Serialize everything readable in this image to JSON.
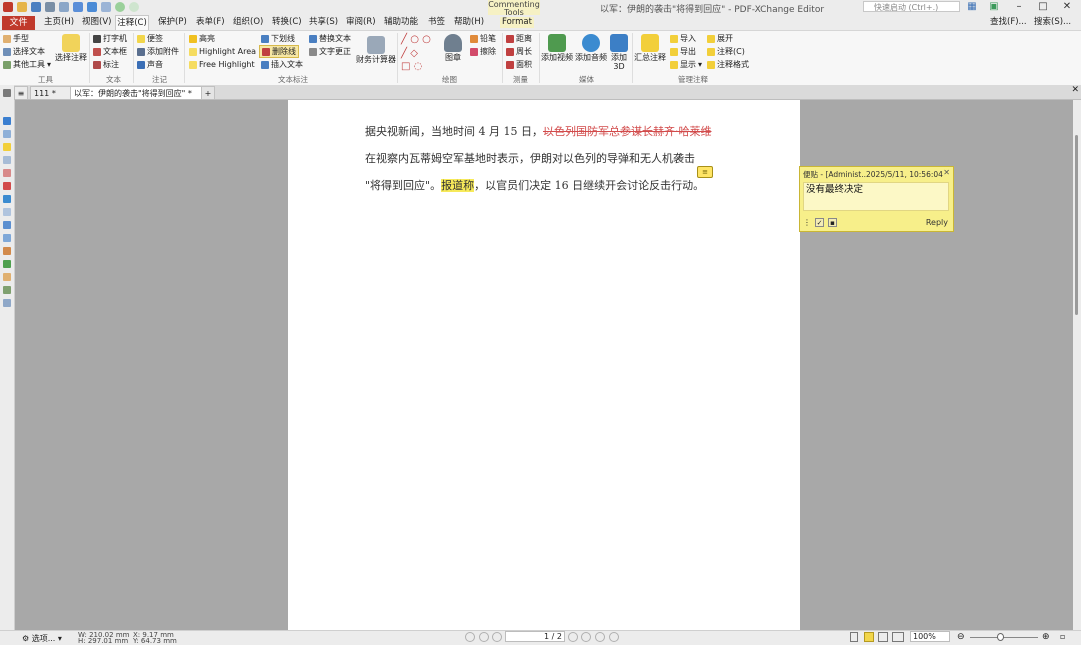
{
  "window": {
    "title": "以军：伊朗的袭击\"将得到回应\" - PDF-XChange Editor",
    "quick_launch_placeholder": "快速启动 (Ctrl+.)",
    "context_group_label": "Commenting Tools"
  },
  "menu": {
    "file": "文件",
    "tabs": [
      "主页(H)",
      "视图(V)",
      "注释(C)",
      "保护(P)",
      "表单(F)",
      "组织(O)",
      "转换(C)",
      "共享(S)",
      "审阅(R)",
      "辅助功能",
      "书签",
      "帮助(H)"
    ],
    "context_tab": "Format",
    "find": "查找(F)...",
    "search": "搜索(S)..."
  },
  "ribbon": {
    "tools": {
      "hand": "手型",
      "select_text": "选择文本",
      "other_tools": "其他工具",
      "group": "工具"
    },
    "select_comment": "选择注释",
    "text": {
      "typewriter": "打字机",
      "textbox": "文本框",
      "callout": "标注",
      "group": "文本"
    },
    "notes": {
      "sticky": "便签",
      "attach_file": "添加附件",
      "sound": "声音",
      "group": "注记"
    },
    "markup": {
      "highlight": "高亮",
      "highlight_area": "Highlight Area",
      "free_highlight": "Free Highlight",
      "underline": "下划线",
      "strikeout": "删除线",
      "insert_text": "插入文本",
      "replace_text": "替换文本",
      "text_correct": "文字更正",
      "group": "文本标注"
    },
    "calculator": "财务计算器",
    "drawing": {
      "stamp": "图章",
      "pencil": "铅笔",
      "eraser": "擦除",
      "group": "绘图"
    },
    "measure": {
      "distance": "距离",
      "perimeter": "周长",
      "area": "面积",
      "group": "测量"
    },
    "media": {
      "add_video": "添加视频",
      "add_audio": "添加音频",
      "add_3d": "添加3D",
      "group": "媒体"
    },
    "manage": {
      "summarize": "汇总注释",
      "import": "导入",
      "export": "导出",
      "show": "显示",
      "expand": "展开",
      "comments": "注释(C)",
      "comment_format": "注释格式",
      "group": "管理注释"
    }
  },
  "doc_tabs": [
    "111 *",
    "以军：伊朗的袭击\"将得到回应\" *"
  ],
  "document": {
    "line1_pre": "据央视新闻，当地时间 4 月 15 日，",
    "line1_strike": "以色列国防军总参谋长赫齐·哈莱维",
    "line2": "在视察内瓦蒂姆空军基地时表示，伊朗对以色列的导弹和无人机袭击",
    "line3_pre": "\"将得到回应\"。",
    "line3_highlight": "报道称",
    "line3_post": "，以官员们决定 16 日继续开会讨论反击行动。"
  },
  "note_popup": {
    "header": "便贴 - [Administ..2025/5/11, 10:56:04",
    "body": "没有最终决定",
    "reply": "Reply"
  },
  "status": {
    "options": "选项...",
    "width": "W: 210.02 mm",
    "height": "H: 297.01 mm",
    "x": "X: 9.17 mm",
    "y": "Y: 64.73 mm",
    "page": "1 / 2",
    "zoom": "100%"
  }
}
